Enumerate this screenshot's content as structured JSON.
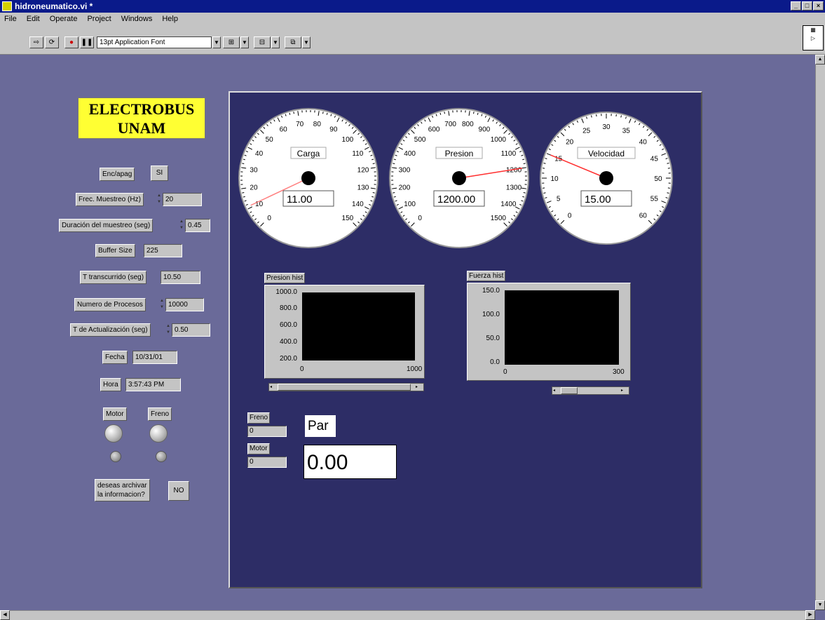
{
  "window": {
    "title": "hidroneumatico.vi *"
  },
  "menu": [
    "File",
    "Edit",
    "Operate",
    "Project",
    "Windows",
    "Help"
  ],
  "toolbar": {
    "font": "13pt Application Font"
  },
  "logo": {
    "line1": "ELECTROBUS",
    "line2": "UNAM"
  },
  "controls": {
    "enc": {
      "label": "Enc/apag",
      "value": "SI"
    },
    "frec": {
      "label": "Frec. Muestreo (Hz)",
      "value": "20"
    },
    "duracion": {
      "label": "Duración del muestreo (seg)",
      "value": "0.45"
    },
    "buffer": {
      "label": "Buffer Size",
      "value": "225"
    },
    "transcurrido": {
      "label": "T transcurrido (seg)",
      "value": "10.50"
    },
    "procesos": {
      "label": "Numero de Procesos",
      "value": "10000"
    },
    "actualizacion": {
      "label": "T de Actualización (seg)",
      "value": "0.50"
    },
    "fecha": {
      "label": "Fecha",
      "value": "10/31/01"
    },
    "hora": {
      "label": "Hora",
      "value": "3:57:43 PM"
    },
    "motor": {
      "label": "Motor"
    },
    "freno": {
      "label": "Freno"
    },
    "archivar": {
      "label1": "deseas archivar",
      "label2": "la informacion?",
      "button": "NO"
    }
  },
  "gauges": [
    {
      "label": "Carga",
      "value": "11.00",
      "reading": 11,
      "min": 0,
      "max": 150,
      "ticks": [
        "0",
        "10",
        "20",
        "30",
        "40",
        "50",
        "60",
        "70",
        "80",
        "90",
        "100",
        "110",
        "120",
        "130",
        "140",
        "150"
      ],
      "needle_color": "#ff8080"
    },
    {
      "label": "Presion",
      "value": "1200.00",
      "reading": 1200,
      "min": 0,
      "max": 1500,
      "ticks": [
        "0",
        "100",
        "200",
        "300",
        "400",
        "500",
        "600",
        "700",
        "800",
        "900",
        "1000",
        "1100",
        "1200",
        "1300",
        "1400",
        "1500"
      ],
      "needle_color": "#ff3030"
    },
    {
      "label": "Velocidad",
      "value": "15.00",
      "reading": 15,
      "min": 0,
      "max": 60,
      "ticks": [
        "0",
        "5",
        "10",
        "15",
        "20",
        "25",
        "30",
        "35",
        "40",
        "45",
        "50",
        "55",
        "60"
      ],
      "needle_color": "#ff3030"
    }
  ],
  "graphs": {
    "presion": {
      "title": "Presion hist",
      "yticks": [
        "1000.0",
        "800.0",
        "600.0",
        "400.0",
        "200.0"
      ],
      "xticks": [
        "0",
        "1000"
      ]
    },
    "fuerza": {
      "title": "Fuerza hist",
      "yticks": [
        "150.0",
        "100.0",
        "50.0",
        "0.0"
      ],
      "xticks": [
        "0",
        "300"
      ]
    }
  },
  "indicators": {
    "freno": {
      "label": "Freno",
      "value": "0"
    },
    "motor": {
      "label": "Motor",
      "value": "0"
    },
    "par": {
      "label": "Par",
      "value": "0.00"
    }
  },
  "icons": {
    "vi_icon": "labview-vi-icon",
    "run": "run-arrow-icon"
  }
}
